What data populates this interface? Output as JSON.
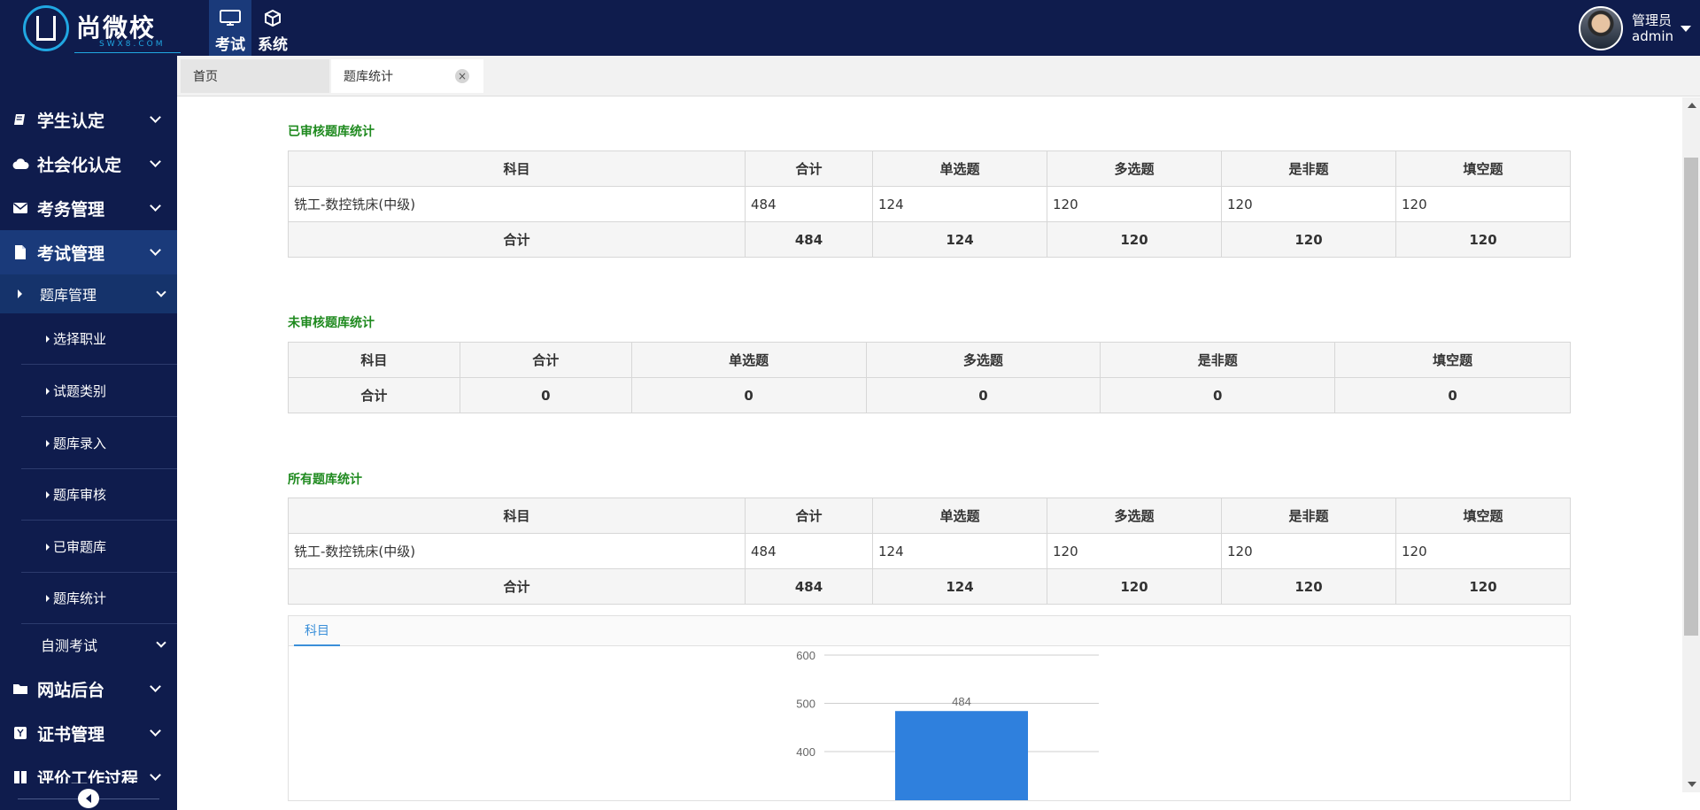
{
  "brand": {
    "name": "尚微校",
    "sub": "SWX8.COM"
  },
  "topnav": [
    {
      "label": "考试",
      "icon": "monitor-icon",
      "active": true
    },
    {
      "label": "系统",
      "icon": "cube-icon",
      "active": false
    }
  ],
  "user": {
    "role": "管理员",
    "name": "admin"
  },
  "sidebar": {
    "groups": [
      {
        "label": "学生认定",
        "icon": "book-icon"
      },
      {
        "label": "社会化认定",
        "icon": "cloud-icon"
      },
      {
        "label": "考务管理",
        "icon": "envelope-icon"
      },
      {
        "label": "考试管理",
        "icon": "file-icon"
      },
      {
        "label": "网站后台",
        "icon": "folder-icon"
      },
      {
        "label": "证书管理",
        "icon": "certificate-icon"
      },
      {
        "label": "评价工作过程",
        "icon": "columns-icon"
      }
    ],
    "sub": {
      "question_bank": "题库管理",
      "self_test": "自测考试"
    },
    "leaves": [
      "选择职业",
      "试题类别",
      "题库录入",
      "题库审核",
      "已审题库",
      "题库统计"
    ]
  },
  "tabs": {
    "home": "首页",
    "stats": "题库统计",
    "close": "×"
  },
  "sections": {
    "approved": {
      "title": "已审核题库统计",
      "headers": [
        "科目",
        "合计",
        "单选题",
        "多选题",
        "是非题",
        "填空题"
      ],
      "rows": [
        [
          "铣工-数控铣床(中级)",
          "484",
          "124",
          "120",
          "120",
          "120"
        ]
      ],
      "total": [
        "合计",
        "484",
        "124",
        "120",
        "120",
        "120"
      ]
    },
    "unapproved": {
      "title": "未审核题库统计",
      "headers": [
        "科目",
        "合计",
        "单选题",
        "多选题",
        "是非题",
        "填空题"
      ],
      "total": [
        "合计",
        "0",
        "0",
        "0",
        "0",
        "0"
      ]
    },
    "all": {
      "title": "所有题库统计",
      "headers": [
        "科目",
        "合计",
        "单选题",
        "多选题",
        "是非题",
        "填空题"
      ],
      "rows": [
        [
          "铣工-数控铣床(中级)",
          "484",
          "124",
          "120",
          "120",
          "120"
        ]
      ],
      "total": [
        "合计",
        "484",
        "124",
        "120",
        "120",
        "120"
      ]
    }
  },
  "chart": {
    "tab": "科目"
  },
  "chart_data": {
    "type": "bar",
    "categories": [
      ""
    ],
    "values": [
      484
    ],
    "ylim": [
      300,
      600
    ],
    "yticks": [
      600,
      500,
      400
    ],
    "grid": true,
    "bar_color": "#2f80dd",
    "data_labels": [
      "484"
    ]
  }
}
